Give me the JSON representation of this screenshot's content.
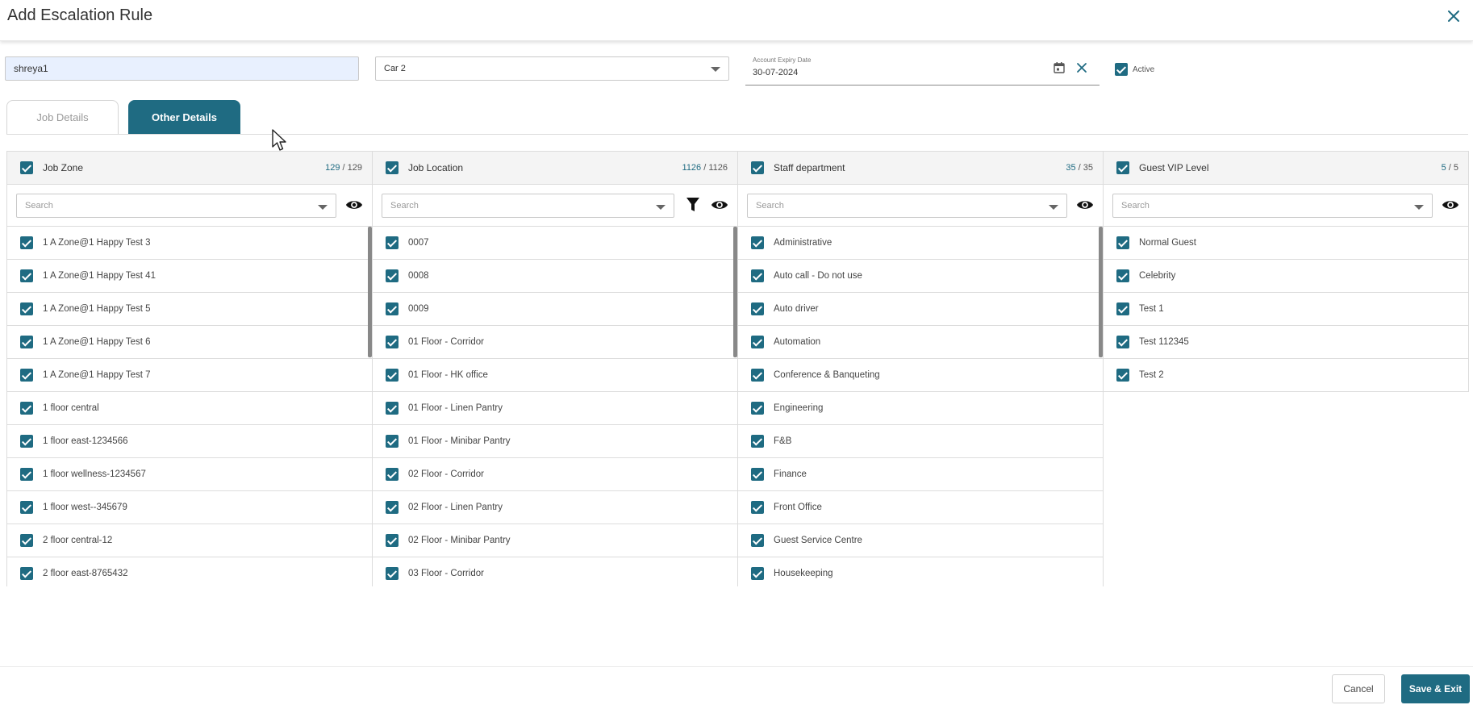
{
  "dialog": {
    "title": "Add Escalation Rule"
  },
  "form": {
    "name_value": "shreya1",
    "select_value": "Car 2",
    "expiry_label": "Account Expiry Date",
    "expiry_value": "30-07-2024",
    "active_label": "Active"
  },
  "tabs": [
    {
      "label": "Job Details",
      "active": false
    },
    {
      "label": "Other Details",
      "active": true
    }
  ],
  "panels": {
    "job_zone": {
      "title": "Job Zone",
      "selected": "129",
      "sep": " / ",
      "total": "129",
      "search_placeholder": "Search",
      "items": [
        "1 A Zone@1 Happy Test 3",
        "1 A Zone@1 Happy Test 41",
        "1 A Zone@1 Happy Test 5",
        "1 A Zone@1 Happy Test 6",
        "1 A Zone@1 Happy Test 7",
        "1 floor central",
        "1 floor east-1234566",
        "1 floor wellness-1234567",
        "1 floor west--345679",
        "2 floor central-12",
        "2 floor east-8765432"
      ]
    },
    "job_location": {
      "title": "Job Location",
      "selected": "1126",
      "sep": " / ",
      "total": "1126",
      "search_placeholder": "Search",
      "items": [
        "0007",
        "0008",
        "0009",
        "01 Floor - Corridor",
        "01 Floor - HK office",
        "01 Floor - Linen Pantry",
        "01 Floor - Minibar Pantry",
        "02 Floor - Corridor",
        "02 Floor - Linen Pantry",
        "02 Floor - Minibar Pantry",
        "03 Floor - Corridor"
      ]
    },
    "staff_department": {
      "title": "Staff department",
      "selected": "35",
      "sep": " / ",
      "total": "35",
      "search_placeholder": "Search",
      "items": [
        "Administrative",
        "Auto call - Do not use",
        "Auto driver",
        "Automation",
        "Conference & Banqueting",
        "Engineering",
        "F&B",
        "Finance",
        "Front Office",
        "Guest Service Centre",
        "Housekeeping"
      ]
    },
    "guest_vip": {
      "title": "Guest VIP Level",
      "selected": "5",
      "sep": " / ",
      "total": "5",
      "search_placeholder": "Search",
      "items": [
        "Normal Guest",
        "Celebrity",
        "Test 1",
        "Test 112345",
        "Test 2"
      ]
    }
  },
  "footer": {
    "cancel_label": "Cancel",
    "save_label": "Save & Exit"
  },
  "colors": {
    "accent": "#1f6b82"
  }
}
